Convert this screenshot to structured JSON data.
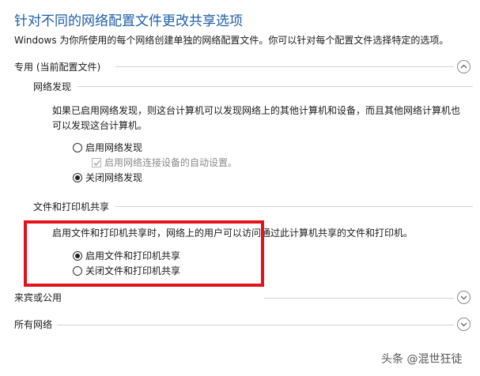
{
  "header": {
    "title": "针对不同的网络配置文件更改共享选项",
    "intro": "Windows 为你所使用的每个网络创建单独的网络配置文件。你可以针对每个配置文件选择特定的选项。"
  },
  "private_profile": {
    "label": "专用 (当前配置文件)",
    "network_discovery": {
      "heading": "网络发现",
      "description": "如果已启用网络发现，则这台计算机可以发现网络上的其他计算机和设备，而且其他网络计算机也可以发现这台计算机。",
      "options": [
        {
          "label": "启用网络发现",
          "selected": false
        },
        {
          "label": "关闭网络发现",
          "selected": true
        }
      ],
      "auto_setup": {
        "label": "启用网络连接设备的自动设置。",
        "checked": true,
        "enabled": false
      }
    },
    "file_printer_sharing": {
      "heading": "文件和打印机共享",
      "description": "启用文件和打印机共享时，网络上的用户可以访问通过此计算机共享的文件和打印机。",
      "options": [
        {
          "label": "启用文件和打印机共享",
          "selected": true
        },
        {
          "label": "关闭文件和打印机共享",
          "selected": false
        }
      ]
    }
  },
  "guest_public_profile": {
    "label": "来宾或公用"
  },
  "all_networks_profile": {
    "label": "所有网络"
  },
  "watermark": "头条 @混世狂徒",
  "colors": {
    "title": "#1e5fa8",
    "highlight": "#e3131b"
  }
}
